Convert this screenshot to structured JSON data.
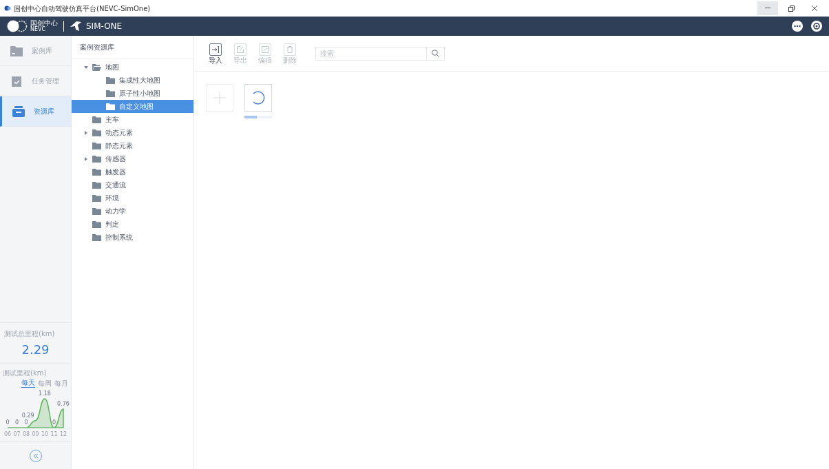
{
  "window": {
    "title": "国创中心自动驾驶仿真平台(NEVC-SimOne)"
  },
  "header": {
    "logo_text": "国创中心",
    "logo_subtext": "NEVC",
    "product": "SIM-ONE"
  },
  "nav": [
    {
      "label": "案例库",
      "kind": "folder",
      "selected": false
    },
    {
      "label": "任务管理",
      "kind": "task",
      "selected": false
    },
    {
      "label": "资源库",
      "kind": "box",
      "selected": true
    }
  ],
  "stats": {
    "total_label": "测试总里程(km)",
    "total_value": "2.29",
    "trend_label": "测试里程(km)",
    "periods": [
      {
        "label": "每天",
        "selected": true
      },
      {
        "label": "每周",
        "selected": false
      },
      {
        "label": "每月",
        "selected": false
      }
    ],
    "chart_data": {
      "type": "area",
      "categories": [
        "06",
        "07",
        "08",
        "09",
        "10",
        "11",
        "12"
      ],
      "series": [
        {
          "color": "#5fb65a",
          "values": [
            0,
            0,
            0,
            0.29,
            1.18,
            0,
            0.76
          ]
        }
      ],
      "data_labels": true
    }
  },
  "tree": {
    "title": "案例资源库",
    "items": [
      {
        "label": "地图",
        "expanded": true,
        "selected": false,
        "children": [
          {
            "label": "集成性大地图",
            "selected": false
          },
          {
            "label": "原子性小地图",
            "selected": false
          },
          {
            "label": "自定义地图",
            "selected": true
          }
        ]
      },
      {
        "label": "主车",
        "selected": false
      },
      {
        "label": "动态元素",
        "expanded": false,
        "selected": false
      },
      {
        "label": "静态元素",
        "selected": false
      },
      {
        "label": "传感器",
        "expanded": false,
        "selected": false
      },
      {
        "label": "触发器",
        "selected": false
      },
      {
        "label": "交通流",
        "selected": false
      },
      {
        "label": "环境",
        "selected": false
      },
      {
        "label": "动力学",
        "selected": false
      },
      {
        "label": "判定",
        "selected": false
      },
      {
        "label": "控制系统",
        "selected": false
      }
    ]
  },
  "toolbar": [
    {
      "label": "导入",
      "kind": "import",
      "disabled": false
    },
    {
      "label": "导出",
      "kind": "export",
      "disabled": true
    },
    {
      "label": "编辑",
      "kind": "edit",
      "disabled": true
    },
    {
      "label": "删除",
      "kind": "delete",
      "disabled": true
    }
  ],
  "search": {
    "placeholder": "搜索"
  },
  "cards": [
    {
      "kind": "add"
    },
    {
      "kind": "loading",
      "level": 0.45
    }
  ]
}
